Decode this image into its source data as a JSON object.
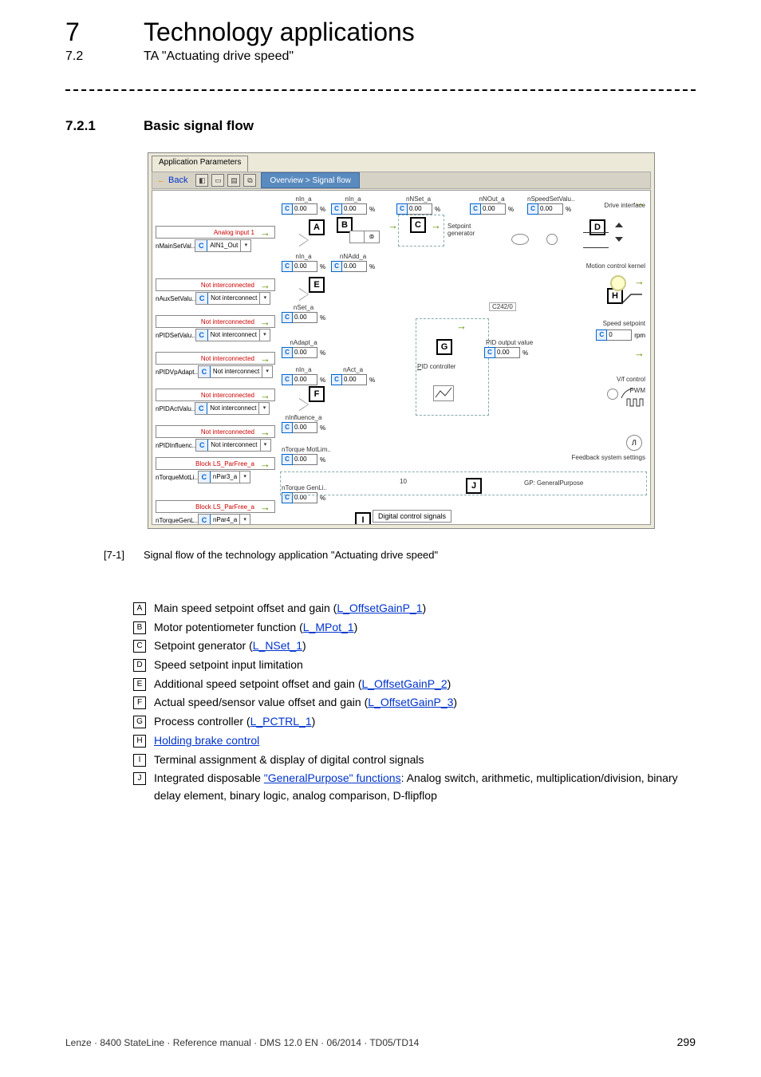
{
  "header": {
    "chapter_num": "7",
    "chapter_title": "Technology applications",
    "section_num": "7.2",
    "section_title": "TA \"Actuating drive speed\"",
    "sub_num": "7.2.1",
    "sub_title": "Basic signal flow"
  },
  "screenshot": {
    "tab": "Application Parameters",
    "back": "Back",
    "breadcrumb": "Overview > Signal flow",
    "top_signals": [
      {
        "name": "nIn_a",
        "val": "0.00",
        "unit": "%"
      },
      {
        "name": "nIn_a",
        "val": "0.00",
        "unit": "%"
      },
      {
        "name": "nNSet_a",
        "val": "0.00",
        "unit": "%"
      },
      {
        "name": "nNOut_a",
        "val": "0.00",
        "unit": "%"
      },
      {
        "name": "nSpeedSetValu..",
        "val": "0.00",
        "unit": "%"
      }
    ],
    "right_labels": {
      "drive_if": "Drive interface",
      "mck": "Motion control kernel",
      "speed_sp": "Speed setpoint",
      "speed_unit": "rpm",
      "speed_val": "0",
      "vf": "V/f control",
      "pwm": "PWM",
      "fb": "Feedback system settings",
      "gp": "GP: GeneralPurpose"
    },
    "mid": {
      "setpoint_gen": "Setpoint\ngenerator",
      "pid_ctrl": "PID controller",
      "pid_out": "PID output value",
      "pid_out_val": "0.00",
      "digital": "Digital control signals",
      "c242": "C242/0",
      "ten": "10"
    },
    "row2": [
      {
        "name": "nIn_a",
        "val": "0.00",
        "unit": "%"
      },
      {
        "name": "nNAdd_a",
        "val": "0.00",
        "unit": "%"
      }
    ],
    "nset": {
      "name": "nSet_a",
      "val": "0.00",
      "unit": "%"
    },
    "nadapt": {
      "name": "nAdapt_a",
      "val": "0.00",
      "unit": "%"
    },
    "rowF": [
      {
        "name": "nIn_a",
        "val": "0.00",
        "unit": "%"
      },
      {
        "name": "nAct_a",
        "val": "0.00",
        "unit": "%"
      }
    ],
    "ninfl": {
      "name": "nInfluence_a",
      "val": "0.00",
      "unit": "%"
    },
    "ntml": {
      "name": "nTorque MotLim..",
      "val": "0.00",
      "unit": "%"
    },
    "ntgl": {
      "name": "nTorque GenLi..",
      "val": "0.00",
      "unit": "%"
    },
    "ports": [
      {
        "label": "Analog input 1",
        "bar_pre": "nMainSetVal.. ",
        "bar": "AIN1_Out"
      },
      {
        "label": "Not interconnected",
        "bar_pre": "nAuxSetValu.. ",
        "bar": "Not interconnect"
      },
      {
        "label": "Not interconnected",
        "bar_pre": "nPIDSetValu.. ",
        "bar": "Not interconnect"
      },
      {
        "label": "Not interconnected",
        "bar_pre": "nPIDVpAdapt.. ",
        "bar": "Not interconnect"
      },
      {
        "label": "Not interconnected",
        "bar_pre": "nPIDActValu.. ",
        "bar": "Not interconnect"
      },
      {
        "label": "Not interconnected",
        "bar_pre": "nPIDInfluenc.. ",
        "bar": "Not interconnect"
      },
      {
        "label": "Block LS_ParFree_a",
        "bar_pre": "nTorqueMotLi.. ",
        "bar": "nPar3_a"
      },
      {
        "label": "Block LS_ParFree_a",
        "bar_pre": "nTorqueGenL.. ",
        "bar": "nPar4_a"
      }
    ]
  },
  "caption": {
    "ref": "[7-1]",
    "text": "Signal flow of the technology application \"Actuating drive speed\""
  },
  "legend": [
    {
      "k": "A",
      "pre": "Main speed setpoint offset and gain (",
      "link": "L_OffsetGainP_1",
      "post": ")"
    },
    {
      "k": "B",
      "pre": "Motor potentiometer function (",
      "link": "L_MPot_1",
      "post": ")"
    },
    {
      "k": "C",
      "pre": "Setpoint generator (",
      "link": "L_NSet_1",
      "post": ")"
    },
    {
      "k": "D",
      "pre": "Speed setpoint input limitation",
      "link": "",
      "post": ""
    },
    {
      "k": "E",
      "pre": "Additional speed setpoint offset and gain (",
      "link": "L_OffsetGainP_2",
      "post": ")"
    },
    {
      "k": "F",
      "pre": "Actual speed/sensor value offset and gain (",
      "link": "L_OffsetGainP_3",
      "post": ")"
    },
    {
      "k": "G",
      "pre": "Process controller (",
      "link": "L_PCTRL_1",
      "post": ")"
    },
    {
      "k": "H",
      "pre": "",
      "link": "Holding brake control",
      "post": ""
    },
    {
      "k": "I",
      "pre": "Terminal assignment & display of digital control signals",
      "link": "",
      "post": ""
    },
    {
      "k": "J",
      "pre": "Integrated disposable ",
      "link": "\"GeneralPurpose\" functions",
      "post": ": Analog switch, arithmetic, multiplication/division, binary delay element, binary logic, analog comparison, D-flipflop"
    }
  ],
  "footer": {
    "left": "Lenze · 8400 StateLine · Reference manual · DMS 12.0 EN · 06/2014 · TD05/TD14",
    "right": "299"
  }
}
